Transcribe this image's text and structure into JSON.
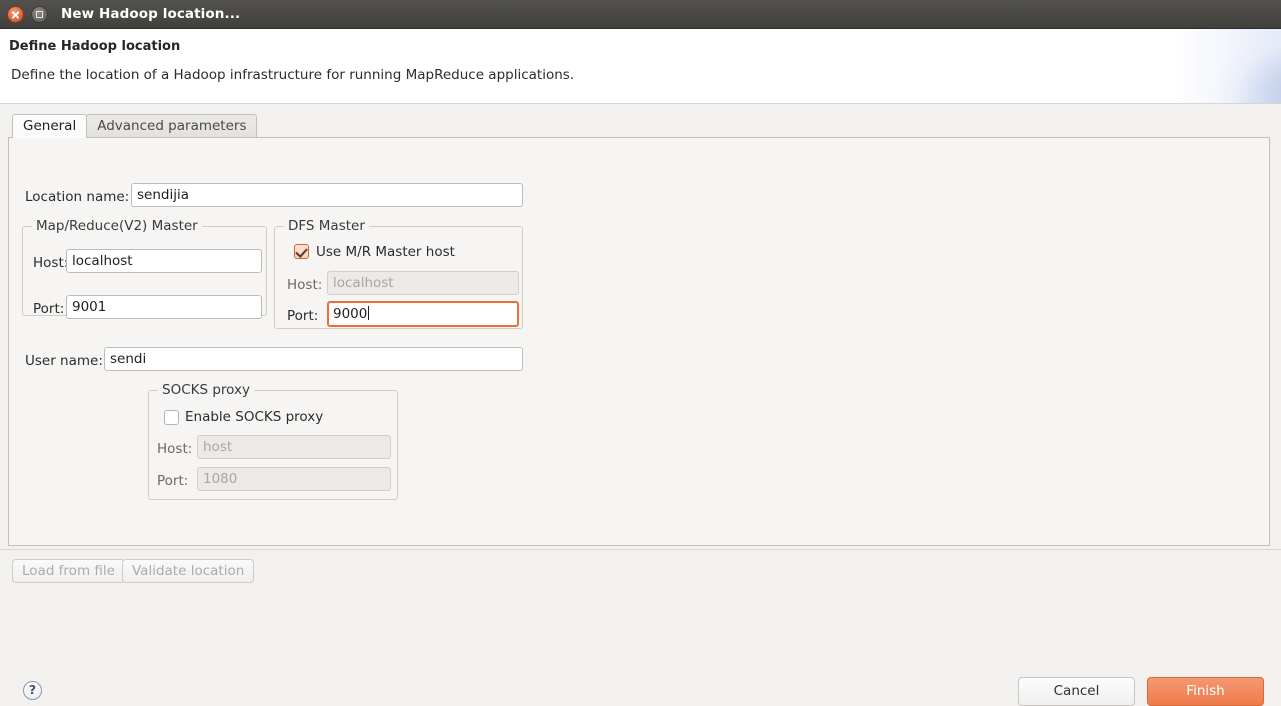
{
  "window": {
    "title": "New Hadoop location...",
    "close_icon": "close-icon",
    "maximize_icon": "maximize-icon"
  },
  "header": {
    "title": "Define Hadoop location",
    "description": "Define the location of a Hadoop infrastructure for running MapReduce applications."
  },
  "tabs": [
    {
      "label": "General",
      "selected": true
    },
    {
      "label": "Advanced parameters",
      "selected": false
    }
  ],
  "general": {
    "location_name": {
      "label": "Location name:",
      "value": "sendijia",
      "placeholder": ""
    },
    "mr_master": {
      "group_title": "Map/Reduce(V2) Master",
      "host": {
        "label": "Host:",
        "value": "localhost"
      },
      "port": {
        "label": "Port:",
        "value": "9001"
      }
    },
    "dfs_master": {
      "group_title": "DFS Master",
      "use_mr_master_host": {
        "label": "Use M/R Master host",
        "checked": true
      },
      "host": {
        "label": "Host:",
        "value": "localhost",
        "disabled": true
      },
      "port": {
        "label": "Port:",
        "value": "9000",
        "focused": true
      }
    },
    "user_name": {
      "label": "User name:",
      "value": "sendi"
    },
    "socks_proxy": {
      "group_title": "SOCKS proxy",
      "enable": {
        "label": "Enable SOCKS proxy",
        "checked": false
      },
      "host": {
        "label": "Host:",
        "value": "host",
        "disabled": true
      },
      "port": {
        "label": "Port:",
        "value": "1080",
        "disabled": true
      }
    }
  },
  "actions": {
    "load_from_file": "Load from file",
    "validate_location": "Validate location",
    "help_icon": "?",
    "cancel": "Cancel",
    "finish": "Finish"
  },
  "colors": {
    "titlebar": "#4b4a46",
    "accent_orange": "#ef7b4c",
    "focus_border": "#e8703a",
    "panel_bg": "#f6f5f4",
    "window_bg": "#f2f1f0"
  }
}
